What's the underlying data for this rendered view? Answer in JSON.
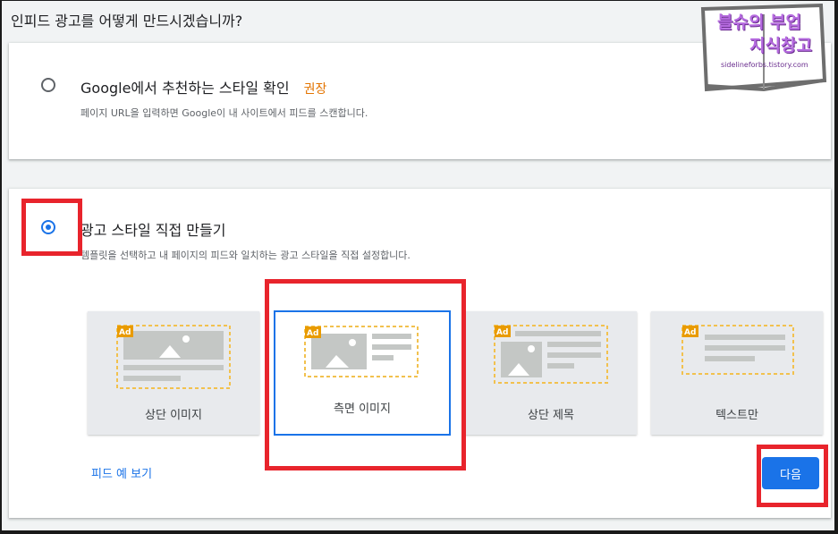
{
  "page": {
    "title": "인피드 광고를 어떻게 만드시겠습니까?"
  },
  "option_google": {
    "title": "Google에서 추천하는 스타일 확인",
    "recommended": "권장",
    "description": "페이지 URL을 입력하면 Google이 내 사이트에서 피드를 스캔합니다.",
    "selected": false
  },
  "option_custom": {
    "title": "광고 스타일 직접 만들기",
    "description": "템플릿을 선택하고 내 페이지의 피드와 일치하는 광고 스타일을 직접 설정합니다.",
    "selected": true
  },
  "templates": [
    {
      "label": "상단 이미지",
      "badge": "Ad",
      "selected": false
    },
    {
      "label": "측면 이미지",
      "badge": "Ad",
      "selected": true
    },
    {
      "label": "상단 제목",
      "badge": "Ad",
      "selected": false
    },
    {
      "label": "텍스트만",
      "badge": "Ad",
      "selected": false
    }
  ],
  "feed_preview_link": "피드 예 보기",
  "next_button": "다음",
  "watermark": {
    "line1": "블슈의 부업",
    "line2": "지식창고",
    "url": "sidelineforbs.tistory.com"
  },
  "colors": {
    "accent": "#1a73e8",
    "recommended": "#e37400",
    "highlight": "#e8242c",
    "ad_badge": "#e99b00"
  }
}
